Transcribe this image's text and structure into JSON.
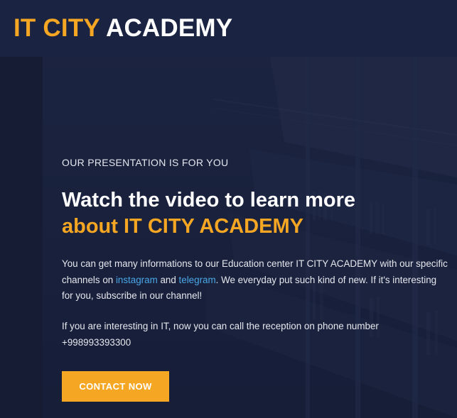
{
  "header": {
    "logo_accent": "IT CITY",
    "logo_main": "ACADEMY"
  },
  "hero": {
    "eyebrow": "OUR PRESENTATION IS FOR YOU",
    "headline_line1": "Watch the video to learn more",
    "headline_line2": "about IT CITY ACADEMY",
    "para1_before": "You can get many informations to our Education center IT CITY ACADEMY with our specific channels on ",
    "link_instagram": "instagram",
    "para1_and": " and ",
    "link_telegram": "telegram",
    "para1_after": ". We everyday put such kind of new. If it's interesting for you, subscribe in our channel!",
    "para2": "If you are interesting in IT, now you can call the reception on phone number +998993393300",
    "cta_label": "CONTACT NOW"
  },
  "colors": {
    "accent": "#f5a623",
    "link": "#4aa8e8",
    "header_bg": "#1a2442",
    "hero_overlay": "#1c2541"
  }
}
